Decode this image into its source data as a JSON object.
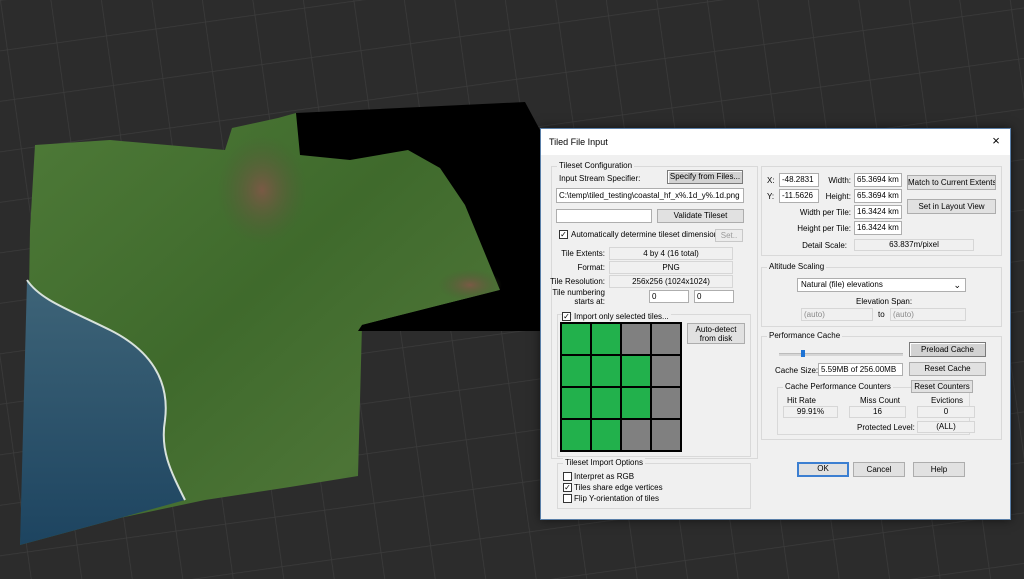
{
  "dialog": {
    "title": "Tiled File Input",
    "close_icon": "×",
    "tileset": {
      "group_title": "Tileset Configuration",
      "input_stream_label": "Input Stream Specifier:",
      "specify_button": "Specify from Files...",
      "path": "C:\\temp\\tiled_testing\\coastal_hf_x%.1d_y%.1d.png",
      "validate_field": "",
      "validate_button": "Validate Tileset",
      "auto_dims_label": "Automatically determine tileset dimensions",
      "auto_dims_checked": true,
      "set_button": "Set..",
      "extents_label": "Tile Extents:",
      "extents_value": "4 by 4 (16 total)",
      "format_label": "Format:",
      "format_value": "PNG",
      "resolution_label": "Tile Resolution:",
      "resolution_value": "256x256 (1024x1024)",
      "numbering_label_1": "Tile numbering",
      "numbering_label_2": "starts at:",
      "numbering_x": "0",
      "numbering_y": "0",
      "import_selected_label": "Import only selected tiles...",
      "import_selected_checked": true,
      "autodetect_button_1": "Auto-detect",
      "autodetect_button_2": "from disk",
      "tiles": [
        [
          true,
          true,
          false,
          false
        ],
        [
          true,
          true,
          true,
          false
        ],
        [
          true,
          true,
          true,
          false
        ],
        [
          true,
          true,
          false,
          false
        ]
      ]
    },
    "import_options": {
      "group_title": "Tileset Import Options",
      "items": [
        {
          "label": "Interpret as RGB",
          "checked": false
        },
        {
          "label": "Tiles share edge vertices",
          "checked": true
        },
        {
          "label": "Flip Y-orientation of tiles",
          "checked": false
        }
      ]
    },
    "extents": {
      "x_label": "X:",
      "x_value": "-48.2831",
      "y_label": "Y:",
      "y_value": "-11.5626",
      "width_label": "Width:",
      "width_value": "65.3694 km",
      "height_label": "Height:",
      "height_value": "65.3694 km",
      "wpt_label": "Width per Tile:",
      "wpt_value": "16.3424 km",
      "hpt_label": "Height per Tile:",
      "hpt_value": "16.3424 km",
      "detail_label": "Detail Scale:",
      "detail_value": "63.837m/pixel",
      "match_button": "Match to Current Extents",
      "layout_button": "Set in Layout View"
    },
    "altitude": {
      "group_title": "Altitude Scaling",
      "mode": "Natural (file) elevations",
      "span_label": "Elevation Span:",
      "span_from": "(auto)",
      "span_to_label": "to",
      "span_to": "(auto)"
    },
    "cache": {
      "group_title": "Performance Cache",
      "slider_level": 0.18,
      "size_label": "Cache Size:",
      "size_value": "5.59MB of 256.00MB",
      "preload_button": "Preload Cache",
      "reset_cache_button": "Reset Cache",
      "counters_title": "Cache Performance Counters",
      "reset_counters_button": "Reset Counters",
      "hit_rate_label": "Hit Rate",
      "hit_rate_value": "99.91%",
      "miss_label": "Miss Count",
      "miss_value": "16",
      "evictions_label": "Evictions",
      "evictions_value": "0",
      "protected_label": "Protected Level:",
      "protected_value": "(ALL)"
    },
    "buttons": {
      "ok": "OK",
      "cancel": "Cancel",
      "help": "Help"
    }
  }
}
